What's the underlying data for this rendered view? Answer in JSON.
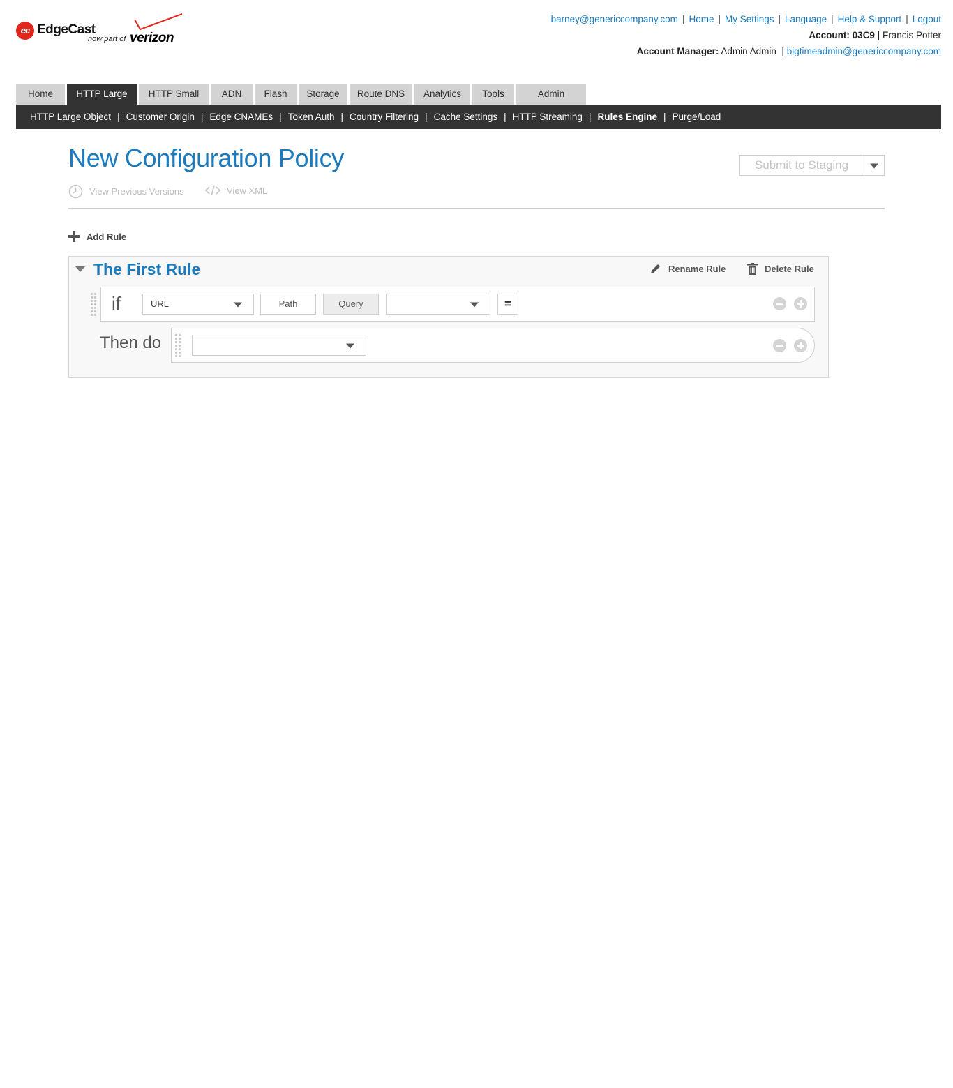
{
  "brand": {
    "name": "EdgeCast",
    "tagline": "now part of",
    "parent": "verizon"
  },
  "header": {
    "links": [
      {
        "label": "barney@genericcompany.com"
      },
      {
        "label": "Home"
      },
      {
        "label": "My Settings"
      },
      {
        "label": "Language"
      },
      {
        "label": "Help & Support"
      },
      {
        "label": "Logout"
      }
    ],
    "account_label": "Account:",
    "account_id": "03C9",
    "account_user": "Francis Potter",
    "manager_label": "Account Manager:",
    "manager_name": "Admin Admin",
    "manager_email": "bigtimeadmin@genericcompany.com"
  },
  "tabs": [
    {
      "label": "Home"
    },
    {
      "label": "HTTP Large",
      "active": true
    },
    {
      "label": "HTTP Small"
    },
    {
      "label": "ADN"
    },
    {
      "label": "Flash"
    },
    {
      "label": "Storage"
    },
    {
      "label": "Route DNS"
    },
    {
      "label": "Analytics"
    },
    {
      "label": "Tools"
    },
    {
      "label": "Admin"
    }
  ],
  "subnav": [
    {
      "label": "HTTP Large Object"
    },
    {
      "label": "Customer Origin"
    },
    {
      "label": "Edge CNAMEs"
    },
    {
      "label": "Token Auth"
    },
    {
      "label": "Country Filtering"
    },
    {
      "label": "Cache Settings"
    },
    {
      "label": "HTTP Streaming"
    },
    {
      "label": "Rules Engine",
      "current": true
    },
    {
      "label": "Purge/Load"
    }
  ],
  "page": {
    "title": "New Configuration Policy",
    "submit_label": "Submit to Staging",
    "view_versions": "View Previous Versions",
    "view_xml": "View XML",
    "add_rule": "Add Rule"
  },
  "rule": {
    "title": "The First Rule",
    "rename": "Rename Rule",
    "delete": "Delete Rule",
    "if_label": "if",
    "condition": {
      "match": "URL",
      "path": "Path",
      "query": "Query",
      "operator_value": "",
      "equals": "="
    },
    "then_label": "Then do",
    "feature_value": ""
  },
  "colors": {
    "accent": "#1a7bbf",
    "nav_dark": "#333333",
    "tab_grey": "#d3d3d3",
    "logo_red": "#e1261c"
  }
}
